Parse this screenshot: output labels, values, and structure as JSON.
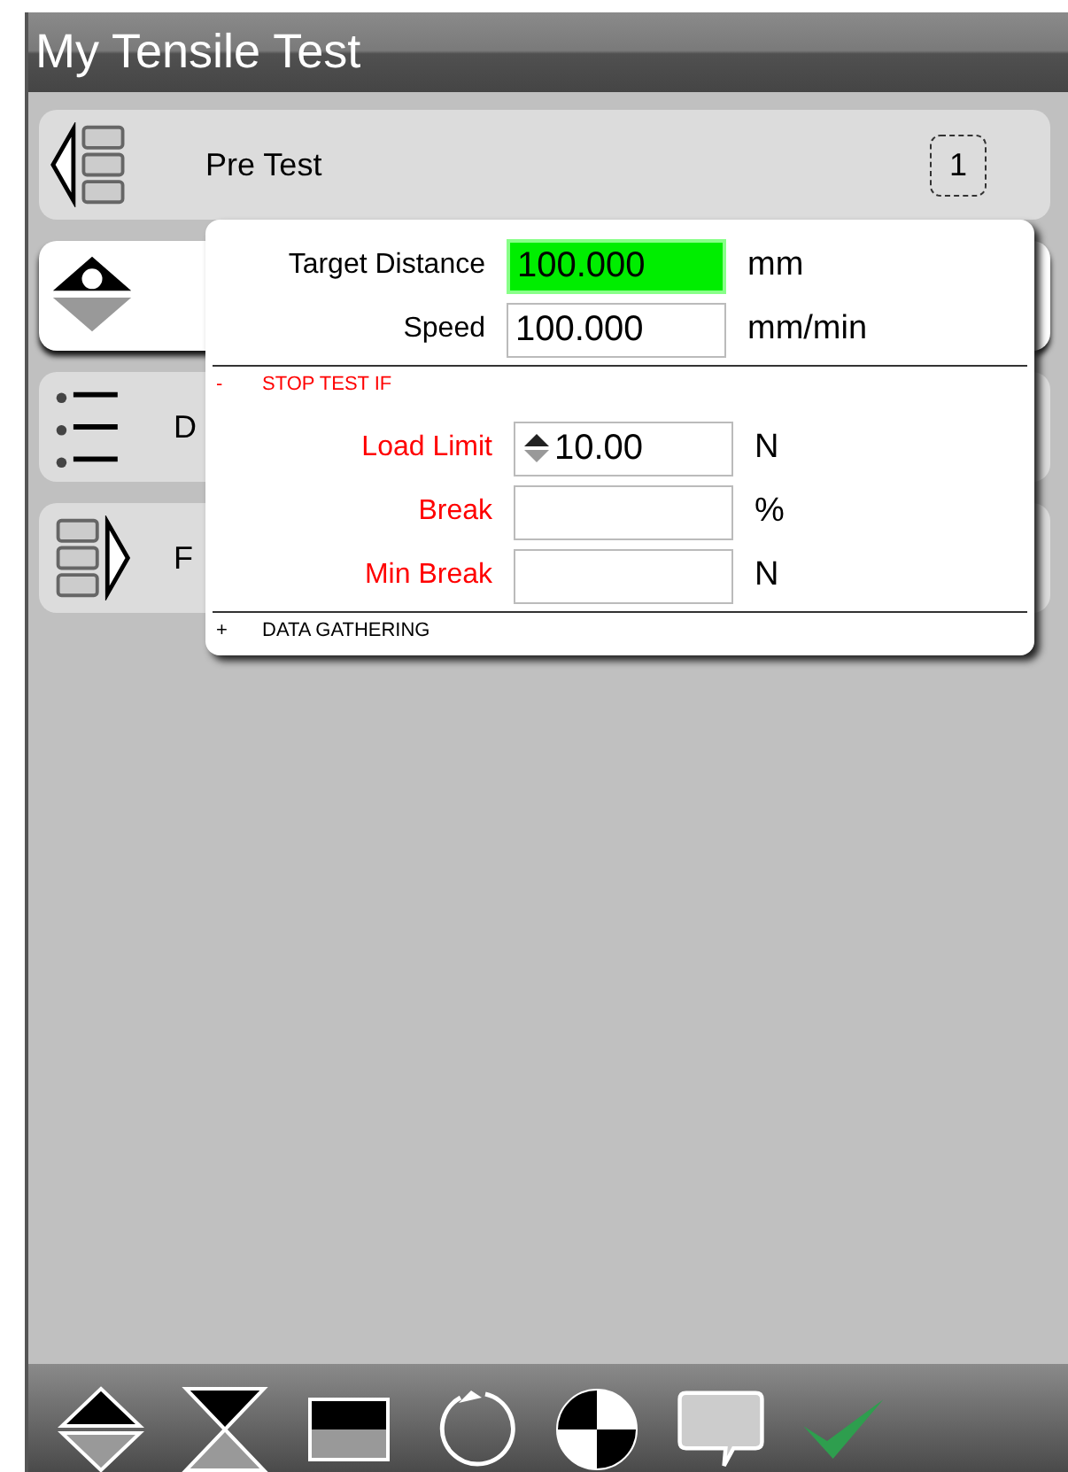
{
  "window": {
    "title": "My Tensile Test"
  },
  "steps": [
    {
      "kind": "pretest",
      "label": "Pre Test",
      "badge": "1",
      "selected": false
    },
    {
      "kind": "test",
      "selected": true
    },
    {
      "kind": "data",
      "label": "D",
      "selected": false
    },
    {
      "kind": "post",
      "label": "F",
      "selected": false
    }
  ],
  "panel": {
    "fields": [
      {
        "label": "Target Distance",
        "value": "100.000",
        "unit": "mm",
        "highlighted": true
      },
      {
        "label": "Speed",
        "value": "100.000",
        "unit": "mm/min",
        "highlighted": false
      }
    ],
    "sections": [
      {
        "toggle": "-",
        "title": "STOP TEST IF",
        "expanded": true,
        "fields": [
          {
            "label": "Load Limit",
            "value": "10.00",
            "unit": "N",
            "highlighted": false,
            "kind": "spinner"
          },
          {
            "label": "Break",
            "unit": "%",
            "highlighted": false
          },
          {
            "label": "Min Break",
            "unit": "N",
            "highlighted": false
          }
        ]
      },
      {
        "toggle": "+",
        "title": "DATA GATHERING",
        "expanded": false
      }
    ]
  }
}
